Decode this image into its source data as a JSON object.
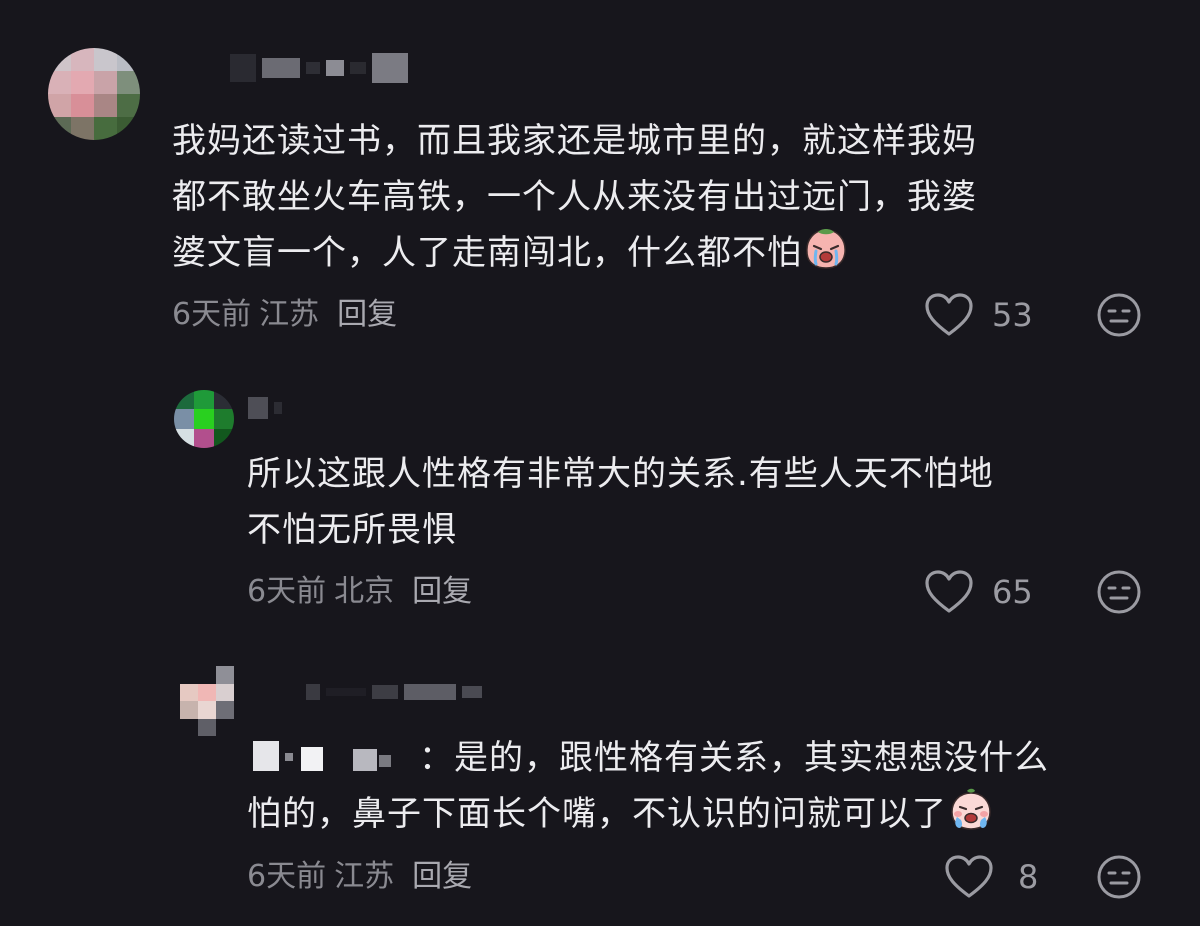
{
  "comments": [
    {
      "content_lines": [
        "我妈还读过书，而且我家还是城市里的，就这样我妈",
        "都不敢坐火车高铁，一个人从来没有出过远门，我婆",
        "婆文盲一个，人了走南闯北，什么都不怕"
      ],
      "emoji": "crying-peach-emoji",
      "time": "6天前",
      "location": "江苏",
      "reply_label": "回复",
      "likes": "53"
    },
    {
      "content_lines": [
        "所以这跟人性格有非常大的关系.有些人天不怕地",
        "不怕无所畏惧"
      ],
      "time": "6天前",
      "location": "北京",
      "reply_label": "回复",
      "likes": "65"
    },
    {
      "content_lines": [
        "：是的，跟性格有关系，其实想想没什么",
        "怕的，鼻子下面长个嘴，不认识的问就可以了"
      ],
      "emoji": "crying-face-emoji",
      "time": "6天前",
      "location": "江苏",
      "reply_label": "回复",
      "likes": "8"
    }
  ],
  "icons": {
    "like": "heart-icon",
    "reaction": "neutral-face-icon"
  },
  "colors": {
    "background": "#17161c",
    "text": "#ececef",
    "meta": "#8a8a91",
    "icon": "#9b9ba2"
  }
}
